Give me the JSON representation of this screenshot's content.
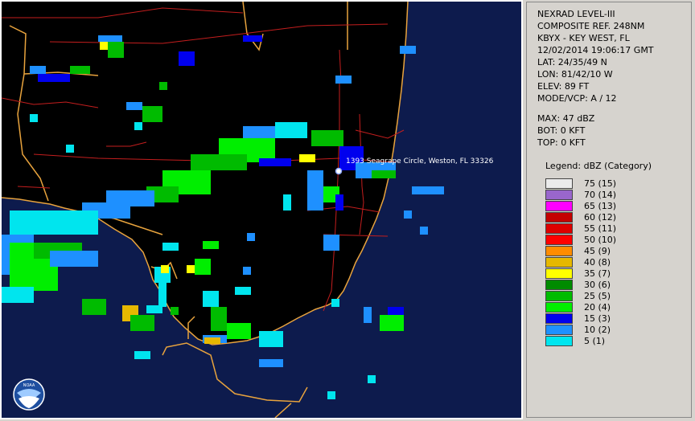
{
  "station_info": {
    "product": "NEXRAD LEVEL-III",
    "type": "COMPOSITE REF. 248NM",
    "station": "KBYX - KEY WEST, FL",
    "datetime": "12/02/2014 19:06:17 GMT",
    "lat": "LAT: 24/35/49 N",
    "lon": "LON: 81/42/10 W",
    "elev": "ELEV: 89 FT",
    "mode": "MODE/VCP: A / 12",
    "max": "MAX: 47 dBZ",
    "bot": "BOT: 0 KFT",
    "top": "TOP: 0 KFT"
  },
  "map": {
    "location_label": "1393 Seagrape Circle, Weston, FL 33326",
    "logo_text": "NOAA"
  },
  "legend": {
    "title": "Legend: dBZ (Category)",
    "entries": [
      {
        "label": "75  (15)",
        "color": "#ebebeb"
      },
      {
        "label": "70  (14)",
        "color": "#9966cc"
      },
      {
        "label": "65  (13)",
        "color": "#ff00ff"
      },
      {
        "label": "60  (12)",
        "color": "#c30000"
      },
      {
        "label": "55  (11)",
        "color": "#dd0000"
      },
      {
        "label": "50  (10)",
        "color": "#ff0000"
      },
      {
        "label": "45  (9)",
        "color": "#ff8c00"
      },
      {
        "label": "40  (8)",
        "color": "#e6b800"
      },
      {
        "label": "35  (7)",
        "color": "#ffff00"
      },
      {
        "label": "30  (6)",
        "color": "#008b00"
      },
      {
        "label": "25  (5)",
        "color": "#00bb00"
      },
      {
        "label": "20  (4)",
        "color": "#00ee00"
      },
      {
        "label": "15  (3)",
        "color": "#0000ee"
      },
      {
        "label": "10  (2)",
        "color": "#1e90ff"
      },
      {
        "label": "5  (1)",
        "color": "#00e5ee"
      }
    ]
  }
}
